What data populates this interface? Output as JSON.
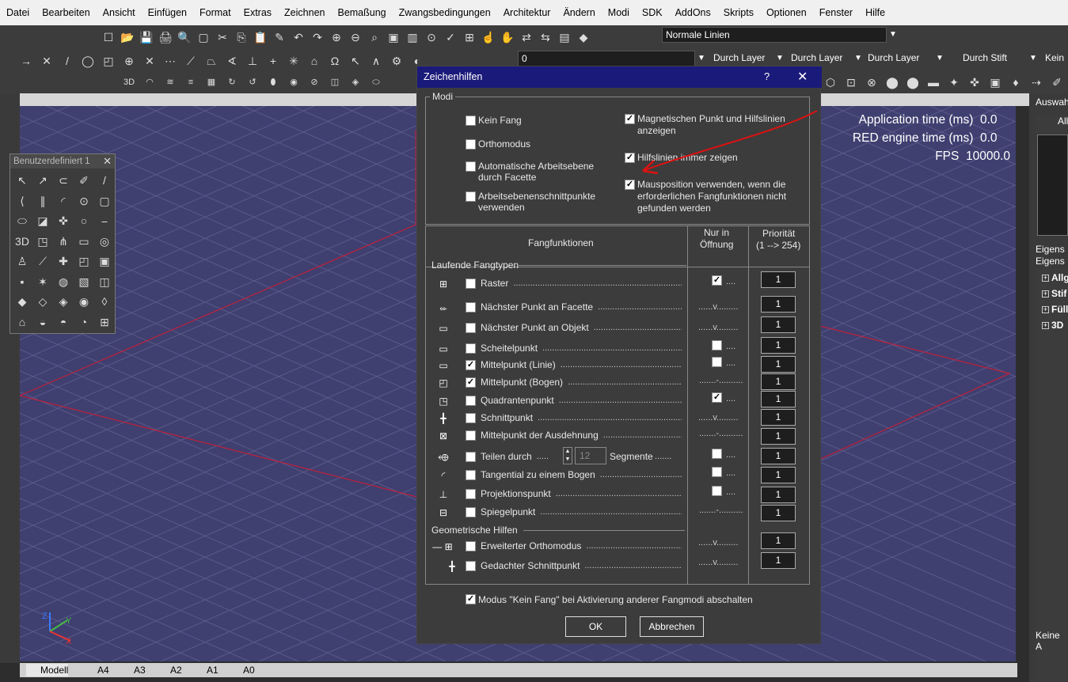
{
  "menu": [
    "Datei",
    "Bearbeiten",
    "Ansicht",
    "Einfügen",
    "Format",
    "Extras",
    "Zeichnen",
    "Bemaßung",
    "Zwangsbedingungen",
    "Architektur",
    "Ändern",
    "Modi",
    "SDK",
    "AddOns",
    "Skripts",
    "Optionen",
    "Fenster",
    "Hilfe"
  ],
  "toolbar": {
    "linetype": "Normale Linien",
    "layer_value": "0",
    "color_by_layer": "Durch Layer",
    "linetype_by_layer": "Durch Layer",
    "lineweight_by_layer": "Durch Layer",
    "plot_by_pen": "Durch Stift",
    "last_combo": "Kein"
  },
  "palette": {
    "title": "Benutzerdefiniert 1"
  },
  "overlay": {
    "app_time_label": "Application time (ms)",
    "app_time_value": "0.0",
    "red_time_label": "RED engine time (ms)",
    "red_time_value": "0.0",
    "fps_label": "FPS",
    "fps_value": "10000.0"
  },
  "right_panel": {
    "header": "Auswah",
    "all": "All",
    "props1": "Eigens",
    "props2": "Eigens",
    "groups": [
      "Allg",
      "Stif",
      "Füll",
      "3D"
    ],
    "footer": "Keine A"
  },
  "tabs": [
    "Modell",
    "A4",
    "A3",
    "A2",
    "A1",
    "A0"
  ],
  "dialog": {
    "title": "Zeichenhilfen",
    "help": "?",
    "modi_label": "Modi",
    "modes_left": [
      {
        "label1": "Kein Fang",
        "label2": "",
        "checked": false
      },
      {
        "label1": "Orthomodus",
        "label2": "",
        "checked": false
      },
      {
        "label1": "Automatische Arbeitsebene",
        "label2": "durch Facette",
        "checked": false
      },
      {
        "label1": "Arbeitsebenenschnittpunkte",
        "label2": "verwenden",
        "checked": false
      }
    ],
    "modes_right": [
      {
        "label1": "Magnetischen Punkt und Hilfslinien",
        "label2": "anzeigen",
        "label3": "",
        "checked": true
      },
      {
        "label1": "Hilfslinien immer zeigen",
        "label2": "",
        "label3": "",
        "checked": true
      },
      {
        "label1": "Mausposition verwenden, wenn die",
        "label2": "erforderlichen Fangfunktionen nicht",
        "label3": "gefunden werden",
        "checked": true
      }
    ],
    "col_functions": "Fangfunktionen",
    "col_only_open_1": "Nur in",
    "col_only_open_2": "Öffnung",
    "col_priority_1": "Priorität",
    "col_priority_2": "(1 --> 254)",
    "group_running": "Laufende Fangtypen",
    "group_geo": "Geometrische Hilfen",
    "snaps": [
      {
        "label": "Raster",
        "checked": false,
        "open": "check",
        "open_checked": true,
        "priority": "1"
      },
      {
        "label": "Nächster Punkt an Facette",
        "checked": false,
        "open": "v",
        "open_checked": false,
        "priority": "1"
      },
      {
        "label": "Nächster Punkt an Objekt",
        "checked": false,
        "open": "v",
        "open_checked": false,
        "priority": "1"
      },
      {
        "label": "Scheitelpunkt",
        "checked": false,
        "open": "check",
        "open_checked": false,
        "priority": "1"
      },
      {
        "label": "Mittelpunkt (Linie)",
        "checked": true,
        "open": "check",
        "open_checked": false,
        "priority": "1"
      },
      {
        "label": "Mittelpunkt (Bogen)",
        "checked": true,
        "open": "dash",
        "open_checked": false,
        "priority": "1"
      },
      {
        "label": "Quadrantenpunkt",
        "checked": false,
        "open": "check",
        "open_checked": true,
        "priority": "1"
      },
      {
        "label": "Schnittpunkt",
        "checked": false,
        "open": "v",
        "open_checked": false,
        "priority": "1"
      },
      {
        "label": "Mittelpunkt der Ausdehnung",
        "checked": false,
        "open": "dash",
        "open_checked": false,
        "priority": "1"
      },
      {
        "label": "Teilen durch",
        "checked": false,
        "open": "check",
        "open_checked": false,
        "priority": "1"
      },
      {
        "label": "Tangential zu einem Bogen",
        "checked": false,
        "open": "check",
        "open_checked": false,
        "priority": "1"
      },
      {
        "label": "Projektionspunkt",
        "checked": false,
        "open": "check",
        "open_checked": false,
        "priority": "1"
      },
      {
        "label": "Spiegelpunkt",
        "checked": false,
        "open": "dash",
        "open_checked": false,
        "priority": "1"
      }
    ],
    "divide_value": "12",
    "divide_unit": "Segmente",
    "geo": [
      {
        "label": "Erweiterter Orthomodus",
        "checked": false,
        "open": "v",
        "priority": "1"
      },
      {
        "label": "Gedachter Schnittpunkt",
        "checked": false,
        "open": "v",
        "priority": "1"
      }
    ],
    "footer_option": "Modus \"Kein Fang\" bei Aktivierung anderer Fangmodi abschalten",
    "footer_checked": true,
    "ok": "OK",
    "cancel": "Abbrechen"
  }
}
